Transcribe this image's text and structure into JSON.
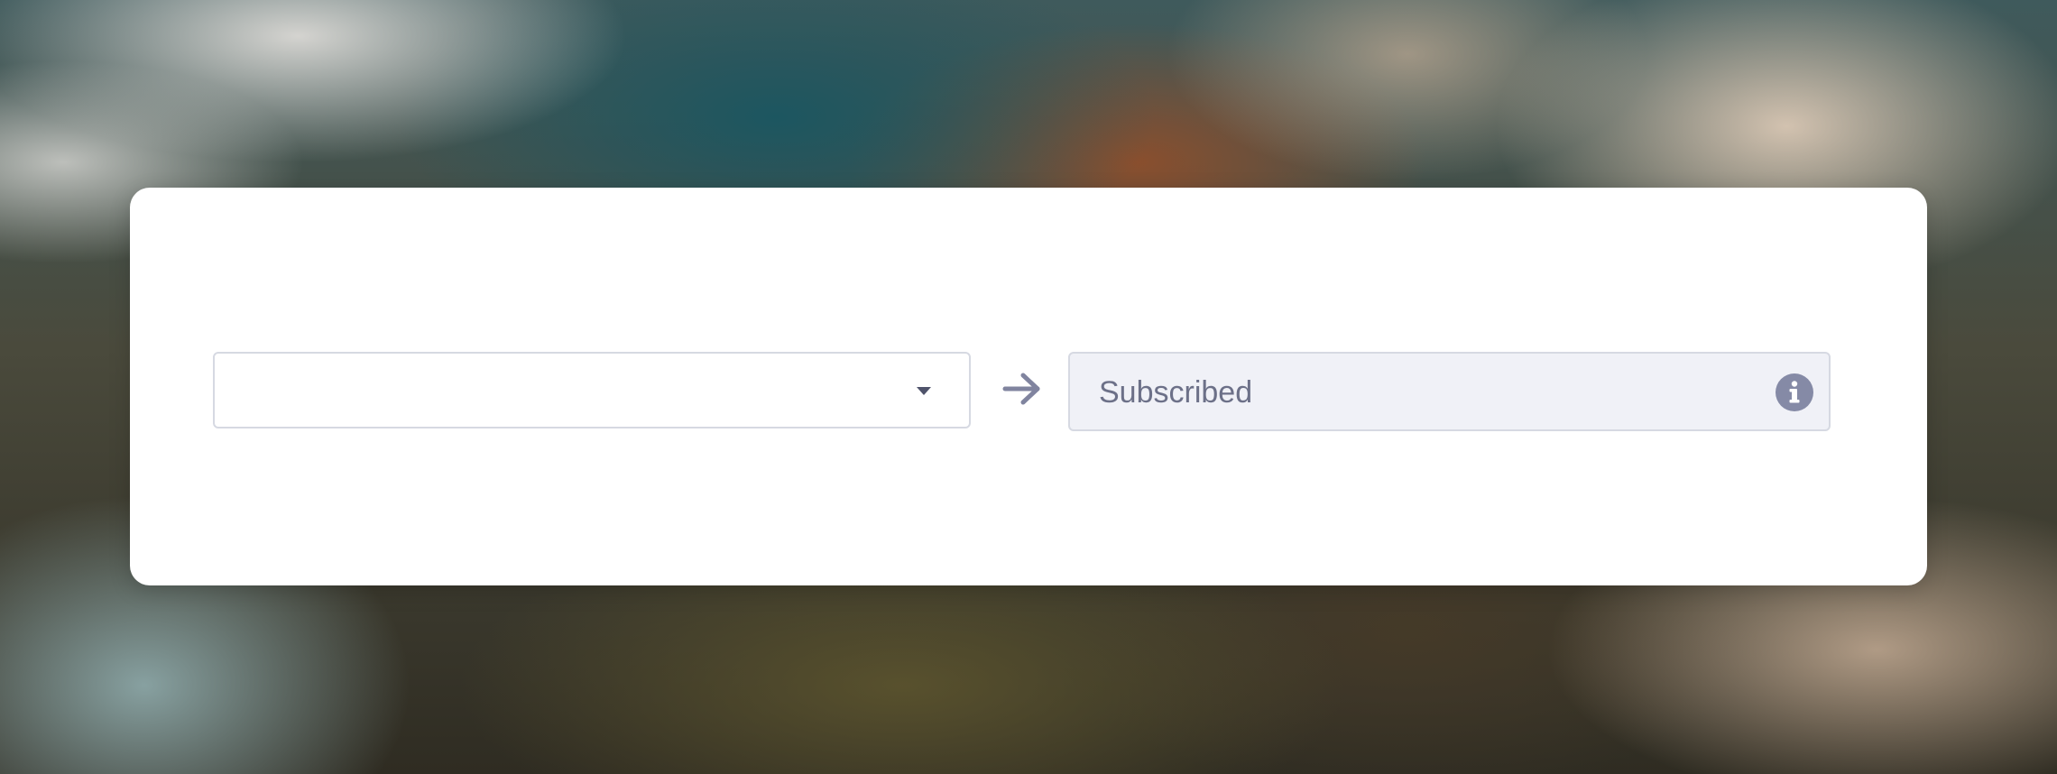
{
  "mapping_row": {
    "source_select": {
      "selected_value": "",
      "icon": "chevron-down-icon"
    },
    "arrow_icon": "arrow-right-icon",
    "target_field": {
      "value": "Subscribed",
      "icon": "info-icon"
    }
  },
  "colors": {
    "card_background": "#ffffff",
    "field_border": "#d6d9e2",
    "readonly_background": "#f0f1f7",
    "icon_color": "#858aa6",
    "text_muted": "#6c7088"
  }
}
